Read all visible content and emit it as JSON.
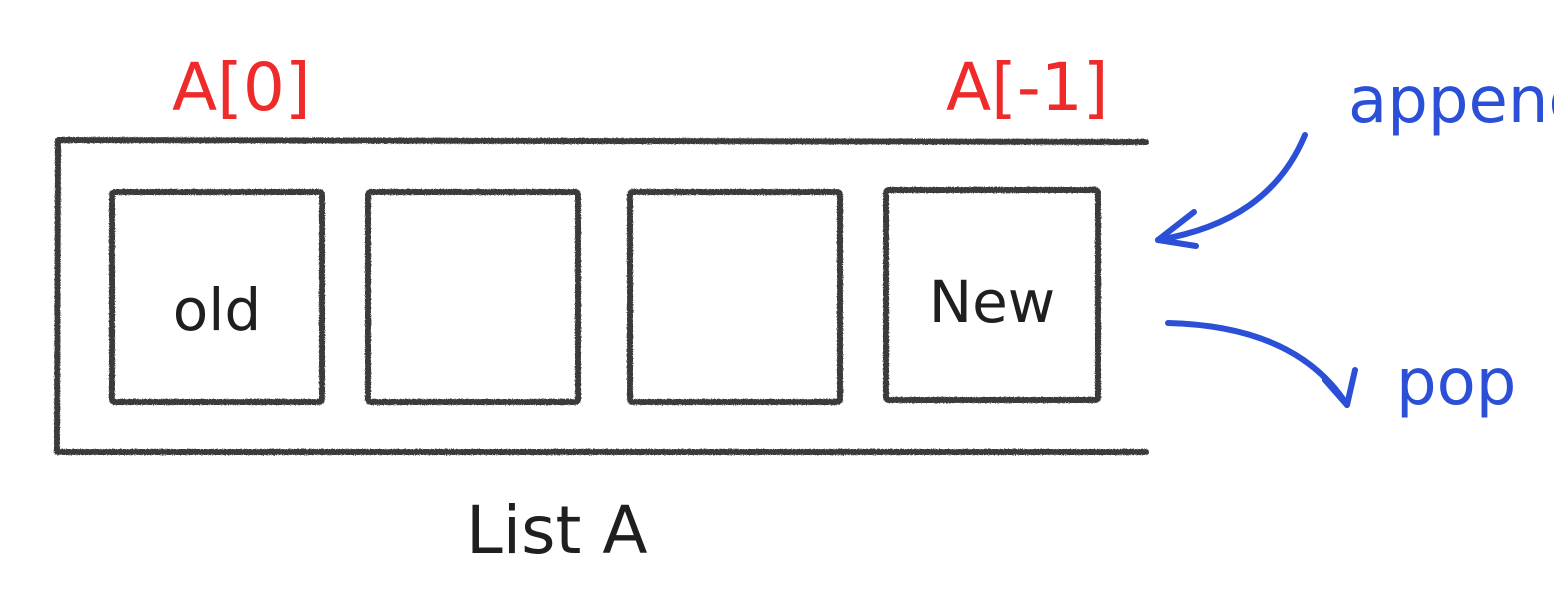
{
  "list": {
    "name": "List A",
    "cells": [
      "old",
      "",
      "",
      "New"
    ]
  },
  "index_labels": {
    "first": "A[0]",
    "last": "A[-1]"
  },
  "operations": {
    "append": "append",
    "pop": "pop"
  },
  "colors": {
    "index_labels": "#ee2a2a",
    "operations": "#2b4fd6",
    "outline": "#3a3a3a",
    "text": "#1f1f1f"
  }
}
